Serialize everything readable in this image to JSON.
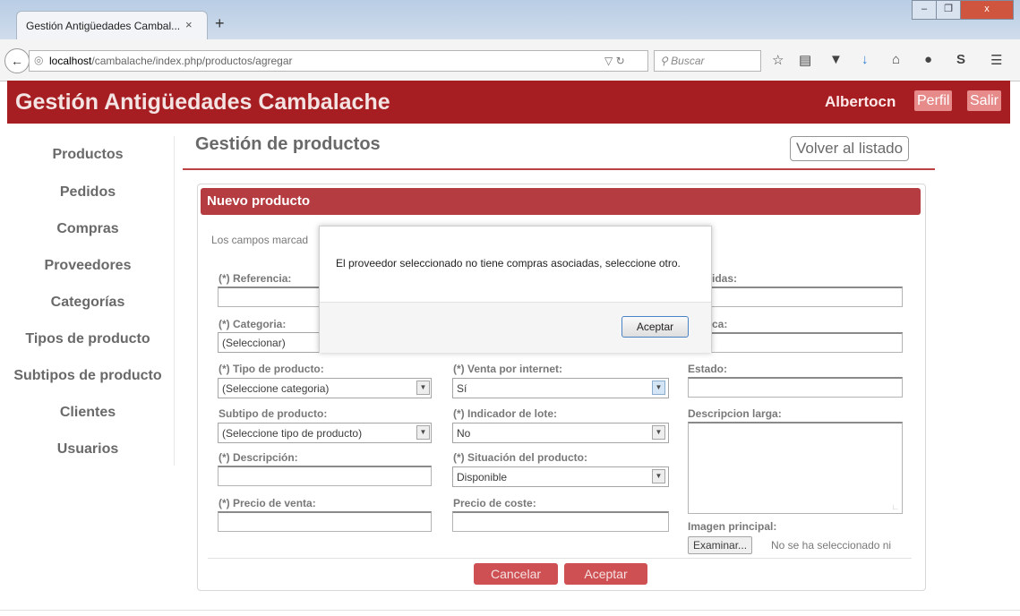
{
  "browser": {
    "tab_title": "Gestión Antigüedades Cambal...",
    "tab_close": "×",
    "new_tab": "+",
    "url_host": "localhost",
    "url_path": "/cambalache/index.php/productos/agregar",
    "search_placeholder": "Buscar",
    "window_buttons": [
      "–",
      "❐",
      "x"
    ],
    "colors": {
      "titlebar": "#c6d6ea"
    }
  },
  "app": {
    "title": "Gestión Antigüedades Cambalache",
    "user": "Albertocn",
    "profile_label": "Perfil",
    "logout_label": "Salir",
    "colors": {
      "brand": "#a61e22",
      "button": "#e68a8a"
    }
  },
  "sidebar": {
    "items": [
      {
        "label": "Productos"
      },
      {
        "label": "Pedidos"
      },
      {
        "label": "Compras"
      },
      {
        "label": "Proveedores"
      },
      {
        "label": "Categorías"
      },
      {
        "label": "Tipos de producto"
      },
      {
        "label": "Subtipos de producto"
      },
      {
        "label": "Clientes"
      },
      {
        "label": "Usuarios"
      }
    ]
  },
  "main": {
    "page_title": "Gestión de productos",
    "back_button": "Volver al listado",
    "panel_title": "Nuevo producto",
    "required_note": "Los campos marcad",
    "fields": {
      "referencia": "(*) Referencia:",
      "categoria": "(*) Categoria:",
      "categoria_value": "(Seleccionar)",
      "tipo": "(*) Tipo de producto:",
      "tipo_value": "(Seleccione categoria)",
      "subtipo": "Subtipo de producto:",
      "subtipo_value": "(Seleccione tipo de producto)",
      "descripcion": "(*) Descripción:",
      "precio_venta": "(*) Precio de venta:",
      "venta_internet": "(*) Venta por internet:",
      "venta_internet_value": "Sí",
      "indicador_lote": "(*) Indicador de lote:",
      "indicador_lote_value": "No",
      "situacion": "(*) Situación del producto:",
      "situacion_value": "Disponible",
      "precio_coste": "Precio de coste:",
      "col3_label1_fragment": "idas:",
      "col3_label2_fragment": "ca:",
      "estado": "Estado:",
      "descripcion_larga": "Descripcion larga:",
      "imagen_principal": "Imagen principal:",
      "file_button": "Examinar...",
      "file_status": "No se ha seleccionado ni"
    },
    "cancel_button": "Cancelar",
    "accept_button": "Aceptar"
  },
  "modal": {
    "message": "El proveedor seleccionado no tiene compras asociadas, seleccione otro.",
    "button": "Aceptar"
  }
}
